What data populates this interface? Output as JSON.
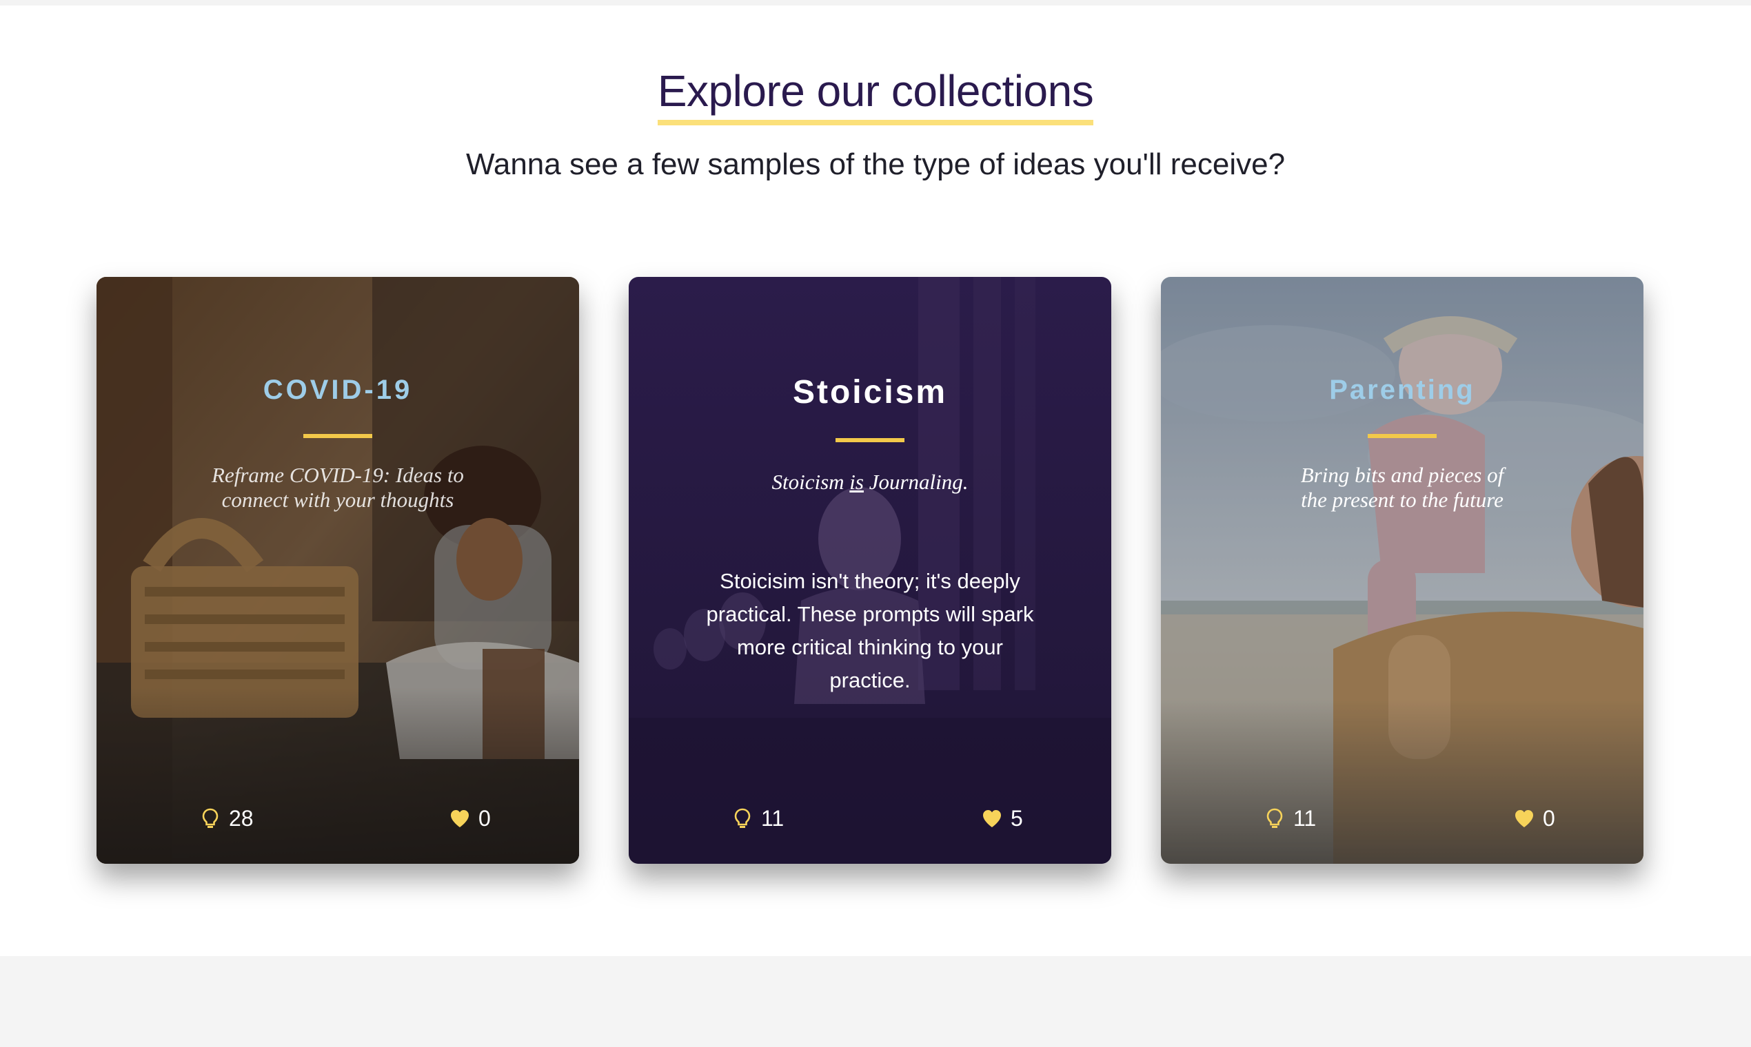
{
  "section": {
    "title": "Explore our collections",
    "subtitle": "Wanna see a few samples of the type of ideas you'll receive?"
  },
  "colors": {
    "heading": "#2a1a4e",
    "underline_accent": "#fbe07a",
    "rule_accent": "#f3c94a",
    "light_blue_title": "#9ecde8",
    "heart": "#f7d35a"
  },
  "cards": [
    {
      "title": "COVID-19",
      "tagline": "Reframe COVID-19: Ideas to connect with your thoughts",
      "ideas_count": "28",
      "likes_count": "0",
      "ideas_icon": "lightbulb-icon",
      "likes_icon": "heart-icon"
    },
    {
      "title": "Stoicism",
      "tagline_before": "Stoicism ",
      "tagline_emph": "is",
      "tagline_after": " Journaling.",
      "description": "Stoicisim isn't theory; it's deeply practical. These prompts will spark more critical thinking to your practice.",
      "ideas_count": "11",
      "likes_count": "5",
      "ideas_icon": "lightbulb-icon",
      "likes_icon": "heart-icon"
    },
    {
      "title": "Parenting",
      "tagline": "Bring bits and pieces of the present to the future",
      "ideas_count": "11",
      "likes_count": "0",
      "ideas_icon": "lightbulb-icon",
      "likes_icon": "heart-icon"
    }
  ]
}
